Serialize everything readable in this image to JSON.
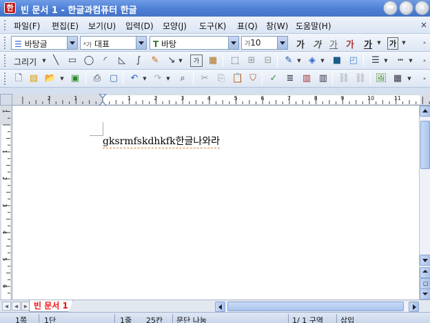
{
  "window": {
    "title": "빈 문서 1 - 한글과컴퓨터 한글",
    "app_icon_glyph": "한"
  },
  "menu": {
    "items": [
      "파일(F)",
      "편집(E)",
      "보기(U)",
      "입력(D)",
      "모양(J)",
      "도구(K)",
      "표(Q)",
      "창(W)",
      "도움말(H)"
    ],
    "close_glyph": "×"
  },
  "format_toolbar": {
    "style_value": "바탕글",
    "lang_value": "대표",
    "font_value": "바탕",
    "size_value": "10",
    "style_buttons": [
      "가",
      "가",
      "가",
      "가",
      "가",
      "가"
    ]
  },
  "draw_toolbar": {
    "label": "그리기"
  },
  "ruler": {
    "h_labels": [
      "2",
      "1",
      "1",
      "2",
      "3",
      "4",
      "5",
      "6",
      "7",
      "8",
      "9",
      "10",
      "11"
    ],
    "v_labels": [
      "1",
      "1",
      "2",
      "3",
      "4",
      "5",
      "6"
    ]
  },
  "document": {
    "text": "gksrmfskdhkfk한글나와라"
  },
  "tabs": {
    "doc_tab": "빈 문서 1"
  },
  "status": {
    "page": "1쪽",
    "section": "1단",
    "line": "1줄",
    "column": "25칸",
    "para_style": "문단 나눔",
    "page_count": "1/ 1 구역",
    "mode": "삽입"
  },
  "colors": {
    "title_bar": "#4d7fd5",
    "tab_text": "#ee1111",
    "workspace": "#d4dff0"
  }
}
